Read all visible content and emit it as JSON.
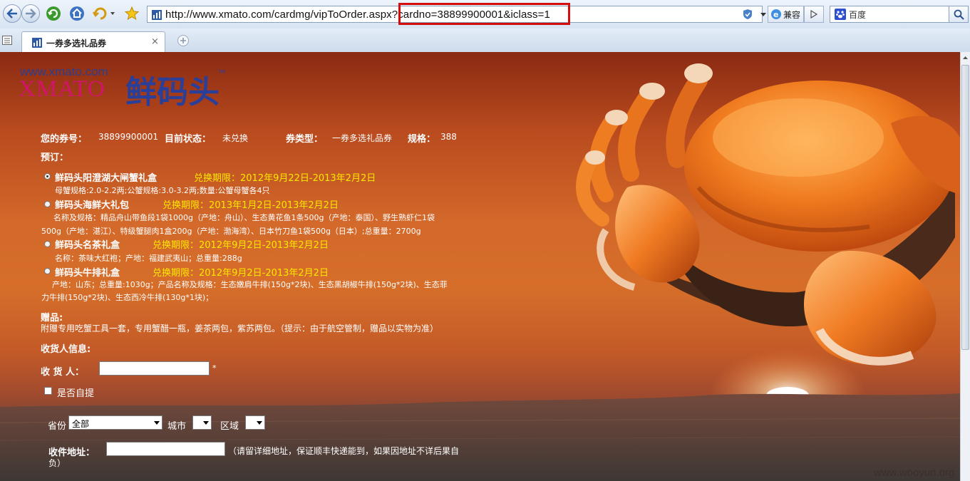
{
  "browser": {
    "url": "http://www.xmato.com/cardmg/vipToOrder.aspx?cardno=38899900001&iclass=1",
    "compat_label": "兼容",
    "search_engine": "百度",
    "tab_title": "一券多选礼品券",
    "tab_close": "×"
  },
  "logo": {
    "domain": "www.xmato.com",
    "brand_en": "XMATO",
    "brand_cn": "鲜码头",
    "tm": "TM"
  },
  "voucher": {
    "number_label": "您的券号：",
    "number": "38899900001",
    "status_label": "目前状态：",
    "status": "未兑换",
    "type_label": "券类型：",
    "type": "一券多选礼品券",
    "spec_label": "规格：",
    "spec": "388"
  },
  "order_label": "预订：",
  "options": [
    {
      "name": "鲜码头阳澄湖大闸蟹礼盒",
      "period": "兑换期限：2012年9月22日-2013年2月2日",
      "desc": [
        "母蟹规格:2.0-2.2两;公蟹规格:3.0-3.2两;数量:公蟹母蟹各4只"
      ],
      "selected": true
    },
    {
      "name": "鲜码头海鲜大礼包",
      "period": "兑换期限：2013年1月2日-2013年2月2日",
      "desc": [
        "名称及规格：精品舟山带鱼段1袋1000g（产地：舟山）、生态黄花鱼1条500g（产地：泰国）、野生熟虾仁1袋",
        "500g（产地：湛江）、特级蟹腿肉1盒200g（产地：渤海湾）、日本竹刀鱼1袋500g（日本）;总重量：2700g"
      ],
      "selected": false
    },
    {
      "name": "鲜码头名茶礼盒",
      "period": "兑换期限：2012年9月2日-2013年2月2日",
      "desc": [
        "名称：茶味大红袍；产地：福建武夷山；总重量:288g"
      ],
      "selected": false
    },
    {
      "name": "鲜码头牛排礼盒",
      "period": "兑换期限：2012年9月2日-2013年2月2日",
      "desc": [
        "产地：山东；总重量:1030g；产品名称及规格：生态嫩肩牛排(150g*2块)、生态黑胡椒牛排(150g*2块)、生态菲",
        "力牛排(150g*2块)、生态西冷牛排(130g*1块)；"
      ],
      "selected": false
    }
  ],
  "gift": {
    "label": "赠品:",
    "text": "附赠专用吃蟹工具一套，专用蟹醋一瓶，姜茶两包，紫苏两包。（提示：由于航空管制，赠品以实物为准）"
  },
  "receiver": {
    "section_label": "收货人信息:",
    "name_label": "收 货 人：",
    "required_mark": "*",
    "self_pickup_label": "是否自提",
    "province_label": "省份",
    "province_value": "全部",
    "city_label": "城市",
    "district_label": "区域",
    "address_label": "收件地址：",
    "address_hint_1": "（请留详细地址，保证顺丰快递能到，如果因地址不详后果自",
    "address_hint_2": "负）"
  },
  "watermark": "www.wooyun.org",
  "colors": {
    "highlight": "#ffe800",
    "annotation": "#d40d0d"
  }
}
